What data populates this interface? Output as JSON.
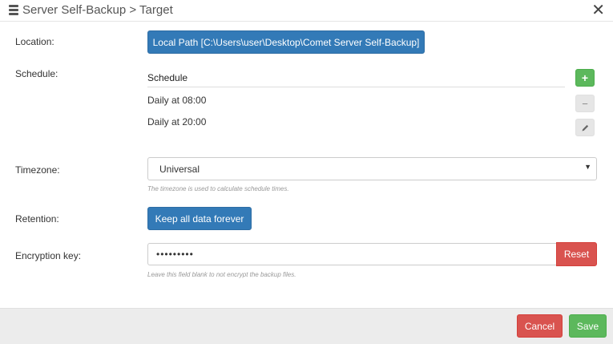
{
  "dialog": {
    "title": "Server Self-Backup > Target",
    "close_symbol": "✕",
    "icon": "server-icon"
  },
  "location": {
    "label": "Location:",
    "button_label": "Local Path [C:\\Users\\user\\Desktop\\Comet Server Self-Backup]"
  },
  "schedule": {
    "label": "Schedule:",
    "header": "Schedule",
    "items": [
      "Daily at 08:00",
      "Daily at 20:00"
    ],
    "add_symbol": "+",
    "remove_symbol": "−",
    "edit_icon": "pencil-icon"
  },
  "timezone": {
    "label": "Timezone:",
    "selected": "Universal",
    "help": "The timezone is used to calculate schedule times."
  },
  "retention": {
    "label": "Retention:",
    "button_label": "Keep all data forever"
  },
  "encryption": {
    "label": "Encryption key:",
    "value": "•••••••••",
    "reset_label": "Reset",
    "help": "Leave this field blank to not encrypt the backup files."
  },
  "footer": {
    "cancel_label": "Cancel",
    "save_label": "Save"
  },
  "colors": {
    "primary": "#337ab7",
    "success": "#5cb85c",
    "danger": "#d9534f"
  }
}
